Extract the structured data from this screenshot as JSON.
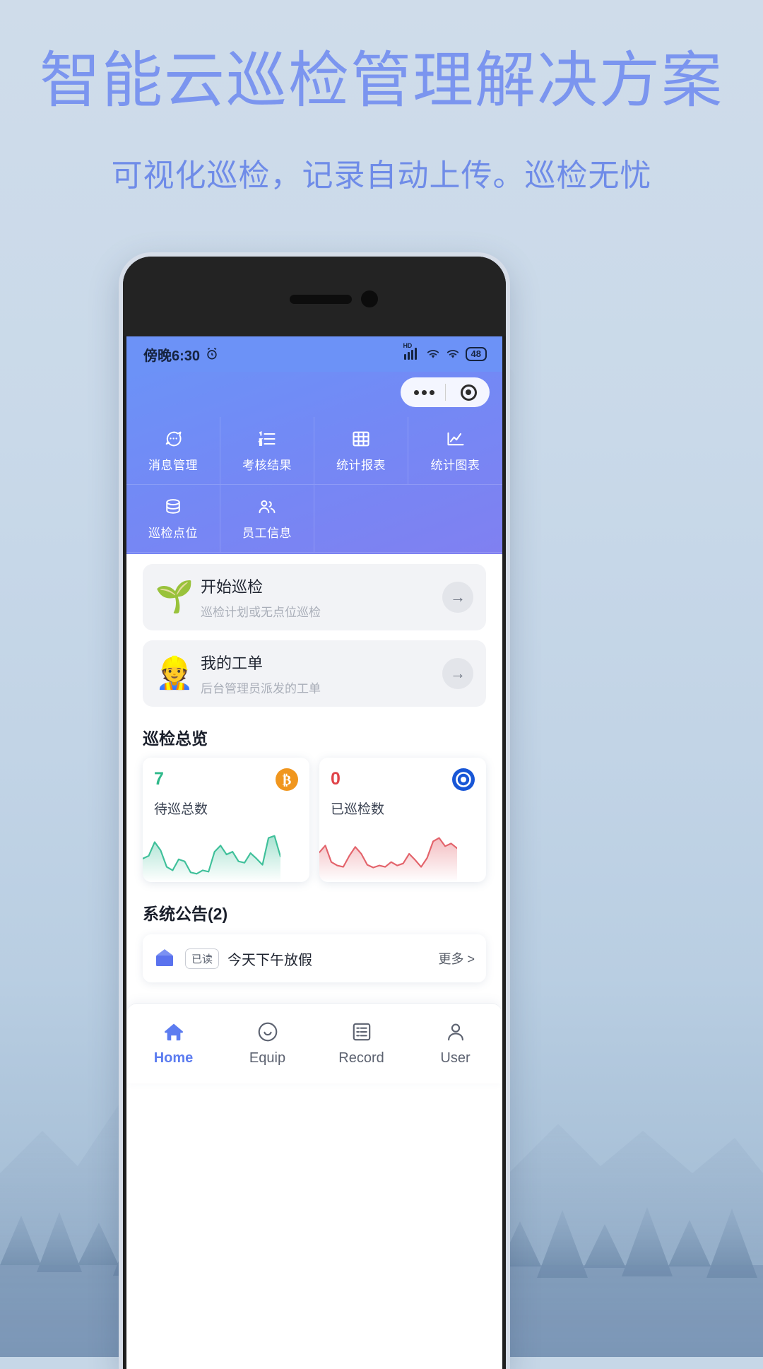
{
  "promo": {
    "title": "智能云巡检管理解决方案",
    "subtitle": "可视化巡检，记录自动上传。巡检无忧",
    "title_color": "#7b95ef",
    "subtitle_color": "#6f8ce8"
  },
  "statusbar": {
    "time": "傍晚6:30",
    "alarm_icon": "alarm-clock-icon",
    "network_label": "HD",
    "signal_icon": "signal-bars-icon",
    "wifi_icon": "wifi-icon",
    "wifi_secondary_icon": "wifi-icon",
    "battery_level": "48"
  },
  "capsule": {
    "more_icon": "more-dots-icon",
    "target_icon": "target-circle-icon"
  },
  "header": {
    "accent_start": "#6c92f7",
    "accent_end": "#8080f1",
    "grid": [
      {
        "label": "消息管理",
        "icon": "chat-bubble-icon"
      },
      {
        "label": "考核结果",
        "icon": "ordered-list-icon"
      },
      {
        "label": "统计报表",
        "icon": "table-grid-icon"
      },
      {
        "label": "统计图表",
        "icon": "line-chart-icon"
      },
      {
        "label": "巡检点位",
        "icon": "database-icon"
      },
      {
        "label": "员工信息",
        "icon": "people-icon"
      }
    ]
  },
  "actions": [
    {
      "emoji": "🌱",
      "emoji_name": "sprout-in-hand-icon",
      "title": "开始巡检",
      "subtitle": "巡检计划或无点位巡检",
      "arrow": "→"
    },
    {
      "emoji": "👷",
      "emoji_name": "construction-worker-icon",
      "title": "我的工单",
      "subtitle": "后台管理员派发的工单",
      "arrow": "→"
    }
  ],
  "overview": {
    "title": "巡检总览",
    "cards": [
      {
        "value": "7",
        "label": "待巡总数",
        "color": "#2fb98a",
        "icon": "bitcoin-coin-icon",
        "icon_color": "#f0961e"
      },
      {
        "value": "0",
        "label": "已巡检数",
        "color": "#e04349",
        "icon": "target-badge-icon",
        "icon_color": "#1856d6"
      }
    ]
  },
  "announcements": {
    "title": "系统公告(2)",
    "items": [
      {
        "icon": "announcement-board-icon",
        "badge": "已读",
        "text": "今天下午放假",
        "more": "更多 >"
      }
    ]
  },
  "tabbar": {
    "active_color": "#5c7cf0",
    "items": [
      {
        "label": "Home",
        "icon": "home-icon",
        "active": true
      },
      {
        "label": "Equip",
        "icon": "smiley-face-icon",
        "active": false
      },
      {
        "label": "Record",
        "icon": "document-list-icon",
        "active": false
      },
      {
        "label": "User",
        "icon": "user-icon",
        "active": false
      }
    ]
  },
  "chart_data": [
    {
      "type": "area",
      "title": "待巡总数",
      "color": "#3fc09a",
      "x": [
        0,
        1,
        2,
        3,
        4,
        5,
        6,
        7,
        8,
        9,
        10,
        11,
        12,
        13,
        14,
        15,
        16,
        17,
        18,
        19,
        20,
        21,
        22,
        23
      ],
      "values": [
        42,
        46,
        72,
        60,
        30,
        24,
        44,
        40,
        22,
        20,
        26,
        24,
        56,
        68,
        52,
        56,
        40,
        38,
        54,
        44,
        34,
        82,
        86,
        48
      ],
      "ylim": [
        0,
        100
      ],
      "grid": false,
      "legend": "none"
    },
    {
      "type": "area",
      "title": "已巡检数",
      "color": "#e3636b",
      "x": [
        0,
        1,
        2,
        3,
        4,
        5,
        6,
        7,
        8,
        9,
        10,
        11,
        12,
        13,
        14,
        15,
        16,
        17,
        18,
        19,
        20,
        21,
        22,
        23
      ],
      "values": [
        54,
        66,
        36,
        30,
        28,
        48,
        64,
        52,
        32,
        26,
        30,
        28,
        36,
        30,
        34,
        52,
        40,
        28,
        44,
        74,
        80,
        66,
        70,
        62
      ],
      "ylim": [
        0,
        100
      ],
      "grid": false,
      "legend": "none"
    }
  ]
}
